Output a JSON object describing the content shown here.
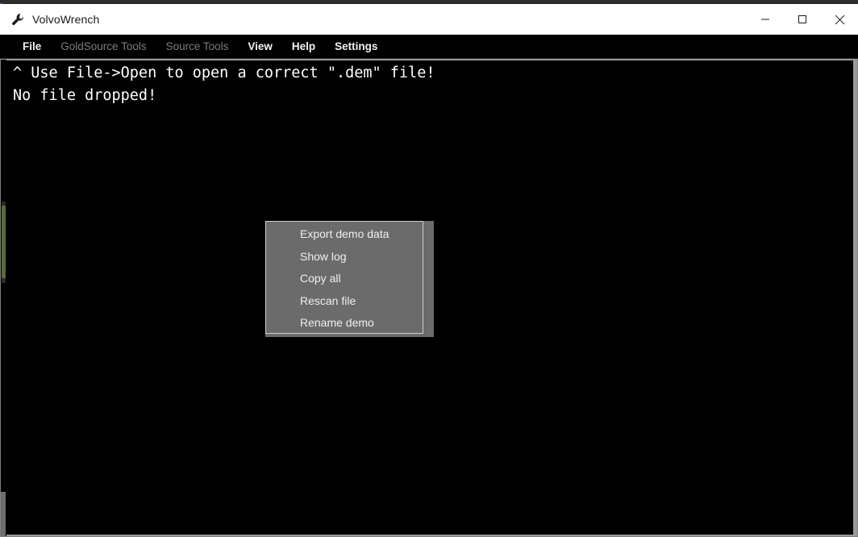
{
  "window": {
    "title": "VolvoWrench",
    "icon": "wrench-icon",
    "controls": {
      "minimize": "minimize-icon",
      "maximize": "maximize-icon",
      "close": "close-icon"
    }
  },
  "menu_bar": {
    "items": [
      {
        "label": "File",
        "disabled": false
      },
      {
        "label": "GoldSource Tools",
        "disabled": true
      },
      {
        "label": "Source Tools",
        "disabled": true
      },
      {
        "label": "View",
        "disabled": false
      },
      {
        "label": "Help",
        "disabled": false
      },
      {
        "label": "Settings",
        "disabled": false
      }
    ]
  },
  "console": {
    "lines": [
      "^ Use File->Open to open a correct \".dem\" file!",
      "No file dropped!"
    ],
    "background": "#000000",
    "text_color": "#ffffff"
  },
  "scrollbar": {
    "thumb_color": "#5b6b38"
  },
  "context_menu": {
    "items": [
      {
        "label": "Export demo data"
      },
      {
        "label": "Show log"
      },
      {
        "label": "Copy all"
      },
      {
        "label": "Rescan file"
      },
      {
        "label": "Rename demo"
      }
    ],
    "background": "#6b6b6b",
    "border_color": "#cfcfcf",
    "text_color": "#efefef"
  }
}
